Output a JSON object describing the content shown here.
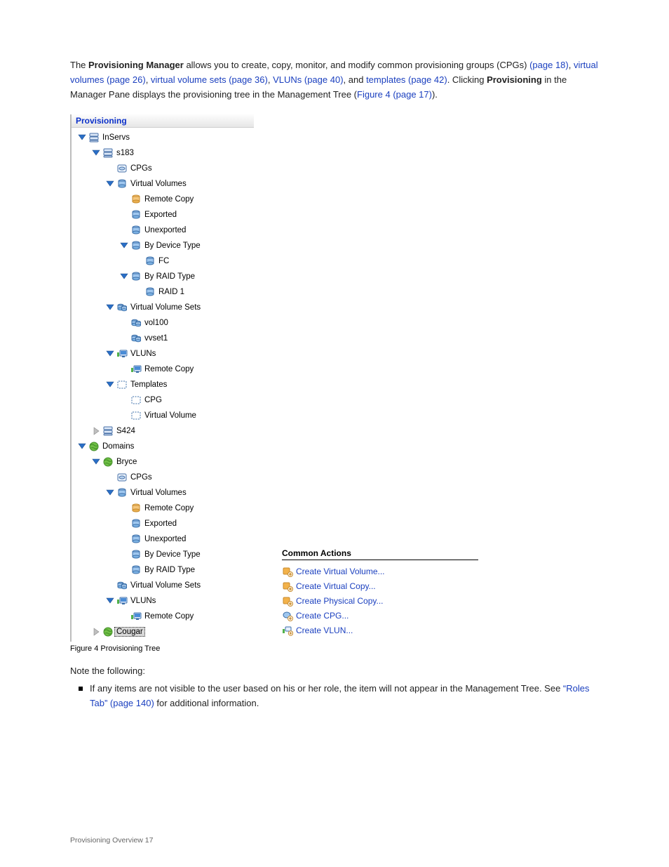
{
  "intro_parts": [
    "The ",
    "Provisioning Manager",
    " allows you to create, copy, monitor, and modify common provisioning groups (CPGs)",
    " (page 18)",
    ", ",
    "virtual volumes",
    " (page 26)",
    ", ",
    "virtual volume sets",
    " (page 36)",
    ", ",
    "VLUNs",
    " (page 40)",
    ", and ",
    "templates",
    " (page 42)",
    ". Clicking ",
    "Provisioning",
    " in the Manager Pane displays the provisioning tree in the Management Tree (",
    "Figure 4 (page 17)",
    ")."
  ],
  "panel_title": "Provisioning",
  "tree": {
    "inservs": "InServs",
    "s183": "s183",
    "cpgs": "CPGs",
    "vv": "Virtual Volumes",
    "rcopy": "Remote Copy",
    "exported": "Exported",
    "unexported": "Unexported",
    "by_device": "By Device Type",
    "fc": "FC",
    "by_raid": "By RAID Type",
    "raid1": "RAID 1",
    "vvsets": "Virtual Volume Sets",
    "vol100": "vol100",
    "vvset1": "vvset1",
    "vluns": "VLUNs",
    "templates": "Templates",
    "tpl_cpg": "CPG",
    "tpl_vv": "Virtual Volume",
    "s424": "S424",
    "domains": "Domains",
    "bryce": "Bryce",
    "cougar": "Cougar"
  },
  "actions_title": "Common Actions",
  "actions": {
    "create_vv": "Create Virtual Volume...",
    "create_vc": "Create Virtual Copy...",
    "create_pc": "Create Physical Copy...",
    "create_cpg": "Create CPG...",
    "create_vlun": "Create VLUN..."
  },
  "caption": "Figure 4 Provisioning Tree",
  "notes_head": "Note the following:",
  "note1": "If any items are not visible to the user based on his or her role, the item will not appear in the Management Tree. See ",
  "note1_link": "“Roles Tab” (page 140)",
  "note1_tail": " for additional information.",
  "footer": "Provisioning Overview    17"
}
